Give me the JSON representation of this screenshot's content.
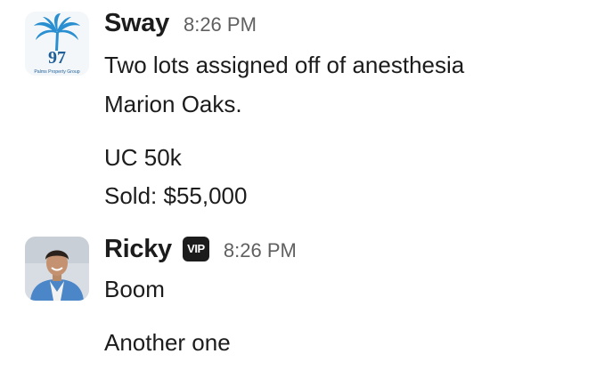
{
  "messages": [
    {
      "sender": "Sway",
      "time": "8:26 PM",
      "avatar": {
        "icon": "palm-tree-logo",
        "logo_number": "97",
        "logo_text": "Palms Property Group",
        "colors": {
          "palm": "#2a8fd0",
          "text": "#1f5f99"
        }
      },
      "lines": [
        "Two lots assigned off of anesthesia",
        "Marion Oaks.",
        "UC 50k",
        "Sold: $55,000"
      ]
    },
    {
      "sender": "Ricky",
      "badge": "VIP",
      "time": "8:26 PM",
      "avatar": {
        "icon": "user-photo"
      },
      "lines": [
        "Boom",
        "Another one"
      ]
    }
  ]
}
